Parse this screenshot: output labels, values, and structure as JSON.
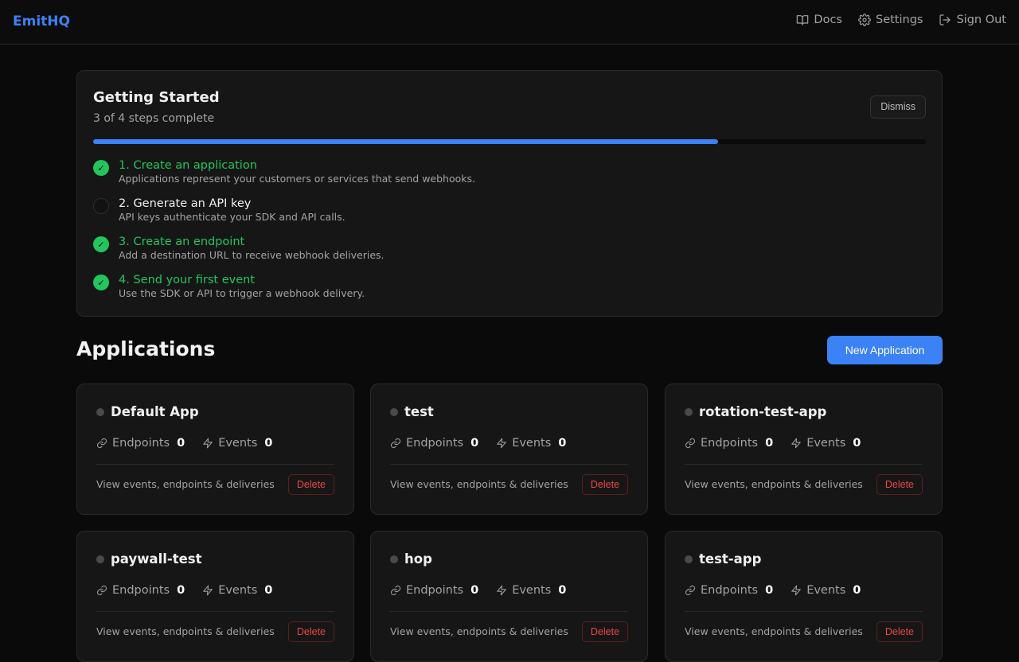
{
  "brand": "EmitHQ",
  "nav": {
    "docs": "Docs",
    "settings": "Settings",
    "sign_out": "Sign Out"
  },
  "getting_started": {
    "title": "Getting Started",
    "subtitle": "3 of 4 steps complete",
    "dismiss": "Dismiss",
    "progress_fraction": 0.75,
    "steps": [
      {
        "title": "1. Create an application",
        "desc": "Applications represent your customers or services that send webhooks.",
        "done": true
      },
      {
        "title": "2. Generate an API key",
        "desc": "API keys authenticate your SDK and API calls.",
        "done": false
      },
      {
        "title": "3. Create an endpoint",
        "desc": "Add a destination URL to receive webhook deliveries.",
        "done": true
      },
      {
        "title": "4. Send your first event",
        "desc": "Use the SDK or API to trigger a webhook delivery.",
        "done": true
      }
    ]
  },
  "applications": {
    "heading": "Applications",
    "new_button": "New Application",
    "endpoints_label": "Endpoints",
    "events_label": "Events",
    "link_text": "View events, endpoints & deliveries",
    "delete_label": "Delete",
    "items": [
      {
        "name": "Default App",
        "endpoints": "0",
        "events": "0"
      },
      {
        "name": "test",
        "endpoints": "0",
        "events": "0"
      },
      {
        "name": "rotation-test-app",
        "endpoints": "0",
        "events": "0"
      },
      {
        "name": "paywall-test",
        "endpoints": "0",
        "events": "0"
      },
      {
        "name": "hop",
        "endpoints": "0",
        "events": "0"
      },
      {
        "name": "test-app",
        "endpoints": "0",
        "events": "0"
      }
    ]
  },
  "colors": {
    "accent": "#3b82f6",
    "success": "#22c55e",
    "danger": "#ef4444"
  }
}
